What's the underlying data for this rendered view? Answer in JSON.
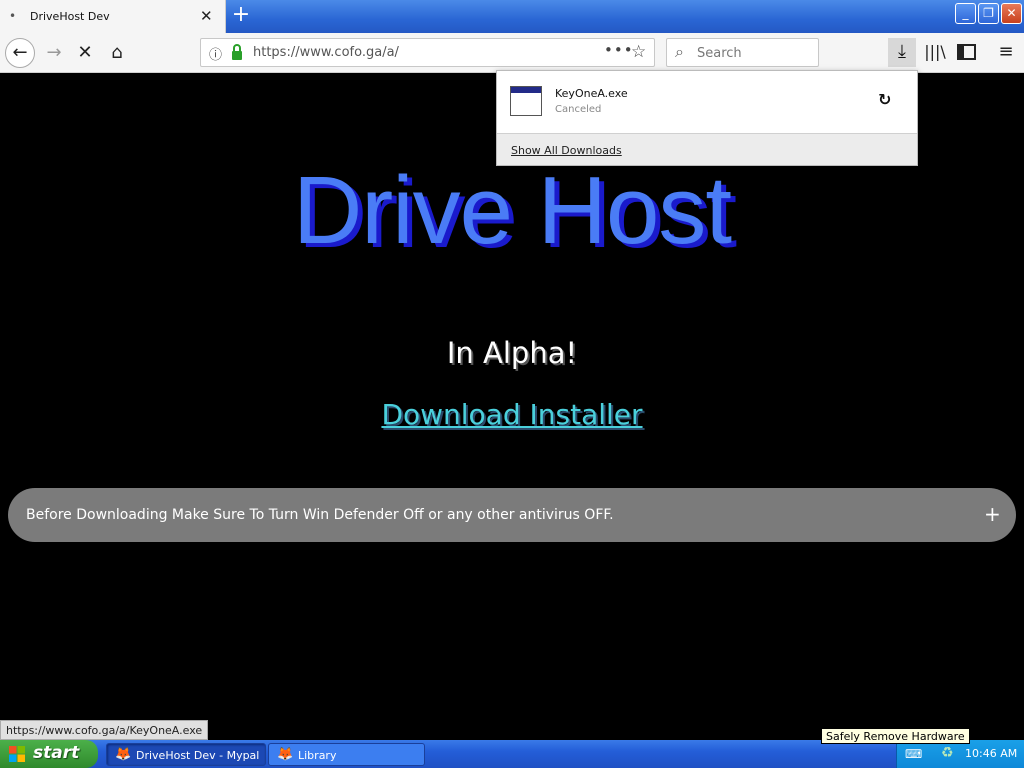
{
  "browser": {
    "tab_title": "DriveHost Dev",
    "tab_dot": "•",
    "tab_close": "✕",
    "new_tab": "+",
    "window_buttons": {
      "minimize": "_",
      "maximize": "❐",
      "close": "✕"
    }
  },
  "navbar": {
    "back": "←",
    "forward": "→",
    "stop": "✕",
    "home": "⌂",
    "info_icon": "ⓘ",
    "url": "https://www.cofo.ga/a/",
    "page_actions": "•••",
    "bookmark_star": "☆",
    "search_icon": "⌕",
    "search_placeholder": "Search",
    "downloads_icon": "⤓",
    "library_icon": "|||\\",
    "menu_icon": "≡"
  },
  "downloads_panel": {
    "file_name": "KeyOneA.exe",
    "file_status": "Canceled",
    "retry_icon": "↻",
    "show_all": "Show All Downloads"
  },
  "page": {
    "headline": "Drive Host",
    "subheadline": "In Alpha!",
    "download_link": "Download Installer",
    "notice_text": "Before Downloading Make Sure To Turn Win Defender Off or any other antivirus OFF.",
    "notice_expand": "+",
    "status_url": "https://www.cofo.ga/a/KeyOneA.exe"
  },
  "taskbar": {
    "start_label": "start",
    "items": [
      {
        "label": "DriveHost Dev - Mypal",
        "icon": "🦊"
      },
      {
        "label": "Library",
        "icon": "🦊"
      }
    ],
    "tray_tooltip": "Safely Remove Hardware",
    "keyboard_icon": "⌨",
    "hardware_icon": "♻",
    "clock": "10:46 AM"
  },
  "colors": {
    "headline": "#4a7cf6",
    "headline_shadow": "#1a1acc",
    "link": "#4ad0dc",
    "notice_bg": "#7b7b7b",
    "taskbar": "#245ed8",
    "start_green": "#3a9a37"
  }
}
